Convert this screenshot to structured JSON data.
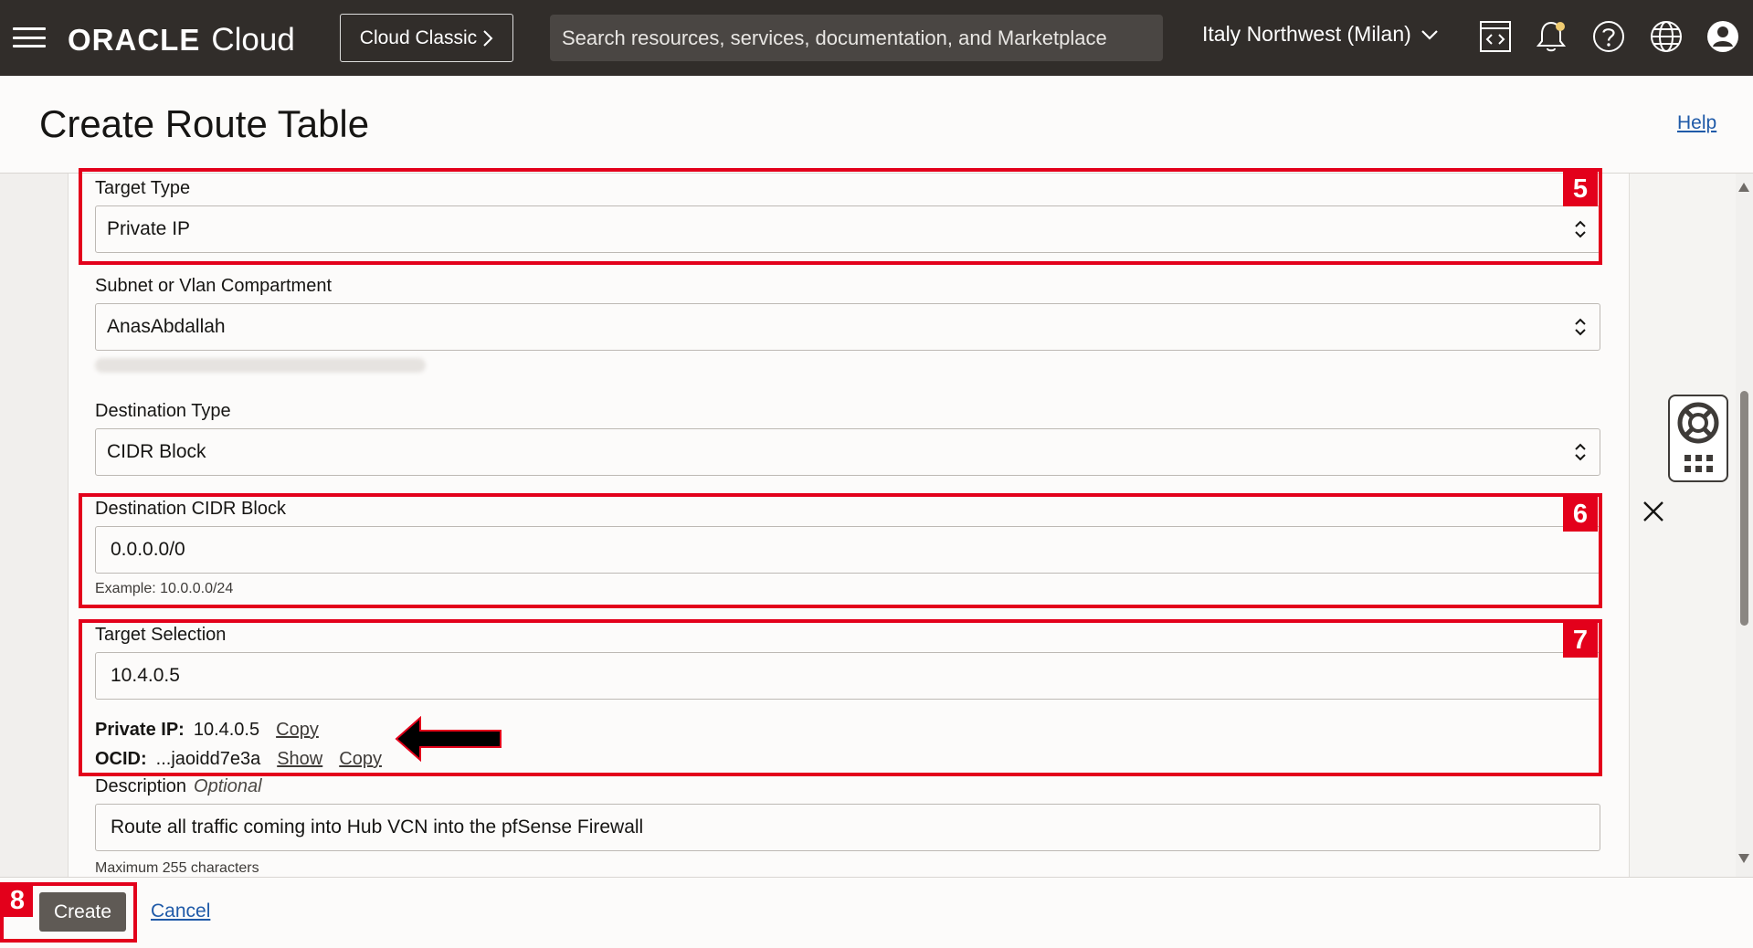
{
  "header": {
    "logo_oracle": "ORACLE",
    "logo_cloud": "Cloud",
    "classic_button": "Cloud Classic",
    "search_placeholder": "Search resources, services, documentation, and Marketplace",
    "region": "Italy Northwest (Milan)",
    "icons": [
      "hamburger-menu-icon",
      "code-editor-icon",
      "bell-icon",
      "help-circle-icon",
      "globe-icon",
      "user-avatar-icon"
    ],
    "background": "#312d2a"
  },
  "page": {
    "title": "Create Route Table",
    "help_link": "Help"
  },
  "form": {
    "target_type": {
      "label": "Target Type",
      "value": "Private IP"
    },
    "subnet_compartment": {
      "label": "Subnet or Vlan Compartment",
      "value": "AnasAbdallah"
    },
    "destination_type": {
      "label": "Destination Type",
      "value": "CIDR Block"
    },
    "destination_cidr": {
      "label": "Destination CIDR Block",
      "value": "0.0.0.0/0",
      "hint": "Example: 10.0.0.0/24"
    },
    "target_selection": {
      "label": "Target Selection",
      "value": "10.4.0.5",
      "private_ip_label": "Private IP:",
      "private_ip_value": "10.4.0.5",
      "copy_link": "Copy",
      "ocid_label": "OCID:",
      "ocid_value": "...jaoidd7e3a",
      "show_link": "Show",
      "copy_link_2": "Copy"
    },
    "description": {
      "label": "Description",
      "optional": "Optional",
      "value": "Route all traffic coming into Hub VCN into the pfSense Firewall",
      "hint": "Maximum 255 characters"
    }
  },
  "callouts": {
    "c5": "5",
    "c6": "6",
    "c7": "7",
    "c8": "8",
    "color": "#e3001b"
  },
  "footer": {
    "create": "Create",
    "cancel": "Cancel"
  }
}
